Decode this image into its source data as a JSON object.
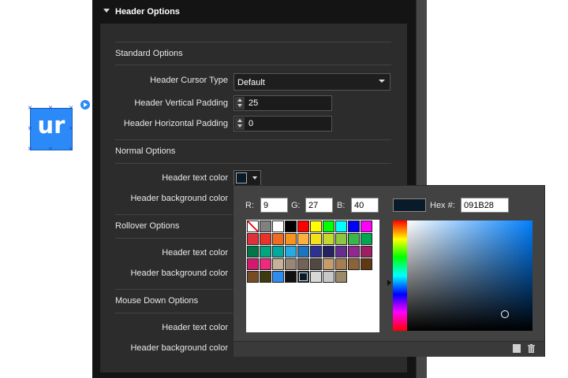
{
  "widget": {
    "text": "ur"
  },
  "panel": {
    "title": "Header Options",
    "sections": {
      "standard": "Standard Options",
      "normal": "Normal Options",
      "rollover": "Rollover Options",
      "mouse_down": "Mouse Down Options"
    },
    "standard": {
      "cursor_label": "Header Cursor Type",
      "cursor_value": "Default",
      "vpad_label": "Header Vertical Padding",
      "vpad_value": "25",
      "hpad_label": "Header Horizontal Padding",
      "hpad_value": "0"
    },
    "normal": {
      "text_color_label": "Header text color",
      "bg_color_label": "Header background color",
      "text_color": "#091B28"
    },
    "rollover": {
      "text_color_label": "Header text color",
      "bg_color_label": "Header background color"
    },
    "mouse_down": {
      "text_color_label": "Header text color",
      "bg_color_label": "Header background color"
    }
  },
  "picker": {
    "r_label": "R:",
    "r_value": "9",
    "g_label": "G:",
    "g_value": "27",
    "b_label": "B:",
    "b_value": "40",
    "hex_label": "Hex #:",
    "hex_value": "091B28",
    "current_color": "#091B28",
    "palette_rows": [
      [
        "none",
        "#808080",
        "#ffffff",
        "#000000",
        "#ff0000",
        "#ffff00",
        "#00ff00",
        "#00ffff",
        "#0000ff",
        "#ff00ff"
      ],
      [
        "#e0303a",
        "#e8322a",
        "#f06a22",
        "#f7941d",
        "#fbb040",
        "#f4e11b",
        "#c4d82d",
        "#8dc63f",
        "#39b54a",
        "#00a651"
      ],
      [
        "#00764a",
        "#00a77e",
        "#00a99d",
        "#27aae1",
        "#1c75bc",
        "#2e3192",
        "#262262",
        "#662d91",
        "#92278f",
        "#9e1f63"
      ],
      [
        "#d5186f",
        "#ed2a7b",
        "#c7b299",
        "#998675",
        "#736357",
        "#534741",
        "#c69c6d",
        "#a67c52",
        "#8c6239",
        "#603913"
      ],
      [
        "#754c24",
        "#3c3a0f",
        "#2d8cf0",
        "#111111",
        "#091b28",
        "#d7d7d7",
        "#c8c8c8",
        "#9a8a6a"
      ]
    ],
    "selected_swatch": "#091b28"
  }
}
